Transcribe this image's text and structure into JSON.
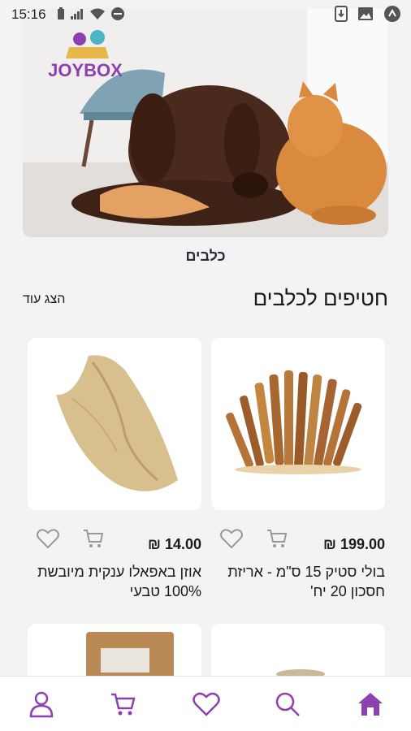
{
  "status_bar": {
    "time": "15:16"
  },
  "hero": {
    "logo_text": "JOYBOX",
    "caption": "כלבים"
  },
  "section": {
    "title": "חטיפים לכלבים",
    "show_more": "הצג עוד"
  },
  "products": [
    {
      "price": "199.00 ₪",
      "name": "בולי סטיק 15 ס\"מ - אריזת חסכון 20 יח'"
    },
    {
      "price": "14.00 ₪",
      "name": "אוזן באפאלו ענקית מיובשת 100% טבעי"
    }
  ],
  "colors": {
    "accent": "#8e3fb0",
    "background": "#f3f3f5"
  },
  "bottom_nav": [
    "home-icon",
    "search-icon",
    "heart-icon",
    "cart-icon",
    "user-icon"
  ]
}
